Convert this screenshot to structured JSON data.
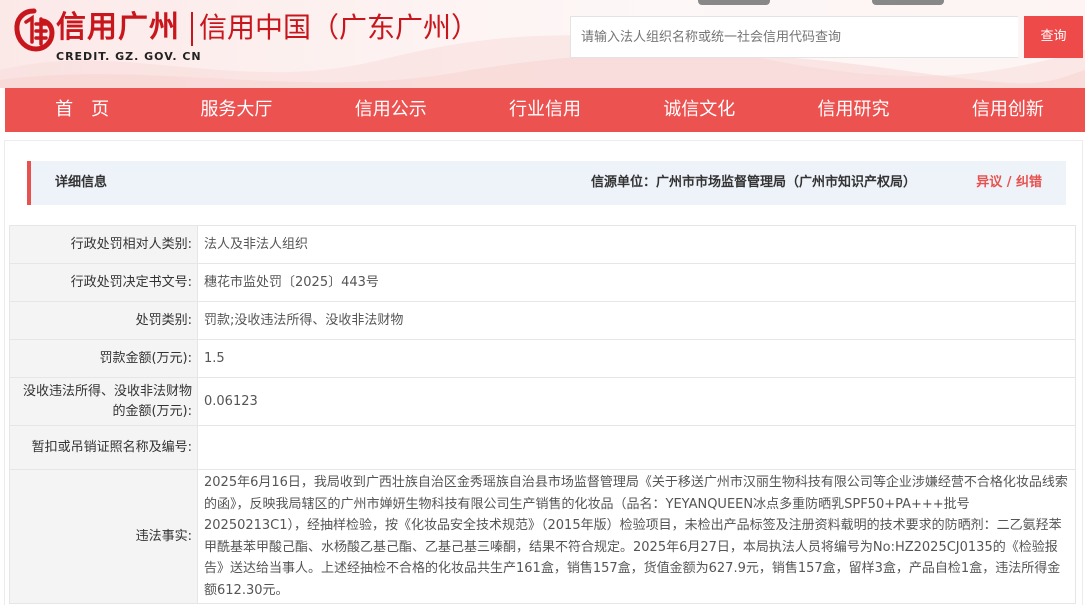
{
  "header": {
    "logo_title": "信用广州",
    "logo_domain": "CREDIT. GZ. GOV. CN",
    "site_subtitle": "信用中国（广东广州）",
    "search": {
      "placeholder": "请输入法人组织名称或统一社会信用代码查询",
      "button_label": "查询"
    }
  },
  "nav": {
    "items": [
      "首　页",
      "服务大厅",
      "信用公示",
      "行业信用",
      "诚信文化",
      "信用研究",
      "信用创新"
    ]
  },
  "detail": {
    "title": "详细信息",
    "source": "信源单位：广州市市场监督管理局（广州市知识产权局）",
    "objection": "异议 / 纠错"
  },
  "rows": [
    {
      "key": "行政处罚相对人类别:",
      "value": "法人及非法人组织"
    },
    {
      "key": "行政处罚决定书文号:",
      "value": "穗花市监处罚〔2025〕443号"
    },
    {
      "key": "处罚类别:",
      "value": "罚款;没收违法所得、没收非法财物"
    },
    {
      "key": "罚款金额(万元):",
      "value": "1.5"
    },
    {
      "key": "没收违法所得、没收非法财物的金额(万元):",
      "value": "0.06123"
    },
    {
      "key": "暂扣或吊销证照名称及编号:",
      "value": ""
    },
    {
      "key": "违法事实:",
      "value": "2025年6月16日，我局收到广西壮族自治区金秀瑶族自治县市场监督管理局《关于移送广州市汉丽生物科技有限公司等企业涉嫌经营不合格化妆品线索的函》，反映我局辖区的广州市婵妍生物科技有限公司生产销售的化妆品（品名：YEYANQUEEN冰点多重防晒乳SPF50+PA+++批号20250213C1），经抽样检验，按《化妆品安全技术规范》（2015年版）检验项目，未检出产品标签及注册资料载明的技术要求的防晒剂：二乙氨羟苯甲酰基苯甲酸己酯、水杨酸乙基己酯、乙基己基三嗪酮，结果不符合规定。2025年6月27日，本局执法人员将编号为No:HZ2025CJ0135的《检验报告》送达给当事人。上述经抽检不合格的化妆品共生产161盒，销售157盒，货值金额为627.9元，销售157盒，留样3盒，产品自检1盒，违法所得金额612.30元。"
    }
  ],
  "colors": {
    "brand_red": "#c8161d",
    "nav_red": "#ec5250",
    "link_red": "#e7514e",
    "detail_bar_bg": "#eef3f9"
  }
}
